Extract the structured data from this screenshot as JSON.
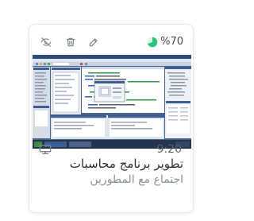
{
  "card": {
    "progress": {
      "text": "%70",
      "value": 0.7,
      "color": "#2ec27e"
    },
    "actions": {
      "hide_icon": "eye-off-icon",
      "delete_icon": "trash-icon",
      "edit_icon": "edit-icon"
    },
    "meta": {
      "type_icon": "monitor-icon",
      "time": "9:20"
    },
    "title": "تطوير برنامج محاسبات",
    "subtitle": "اجتماع مع المطورين",
    "thumbnail": {
      "content": "Visual Studio IDE screenshot"
    }
  }
}
